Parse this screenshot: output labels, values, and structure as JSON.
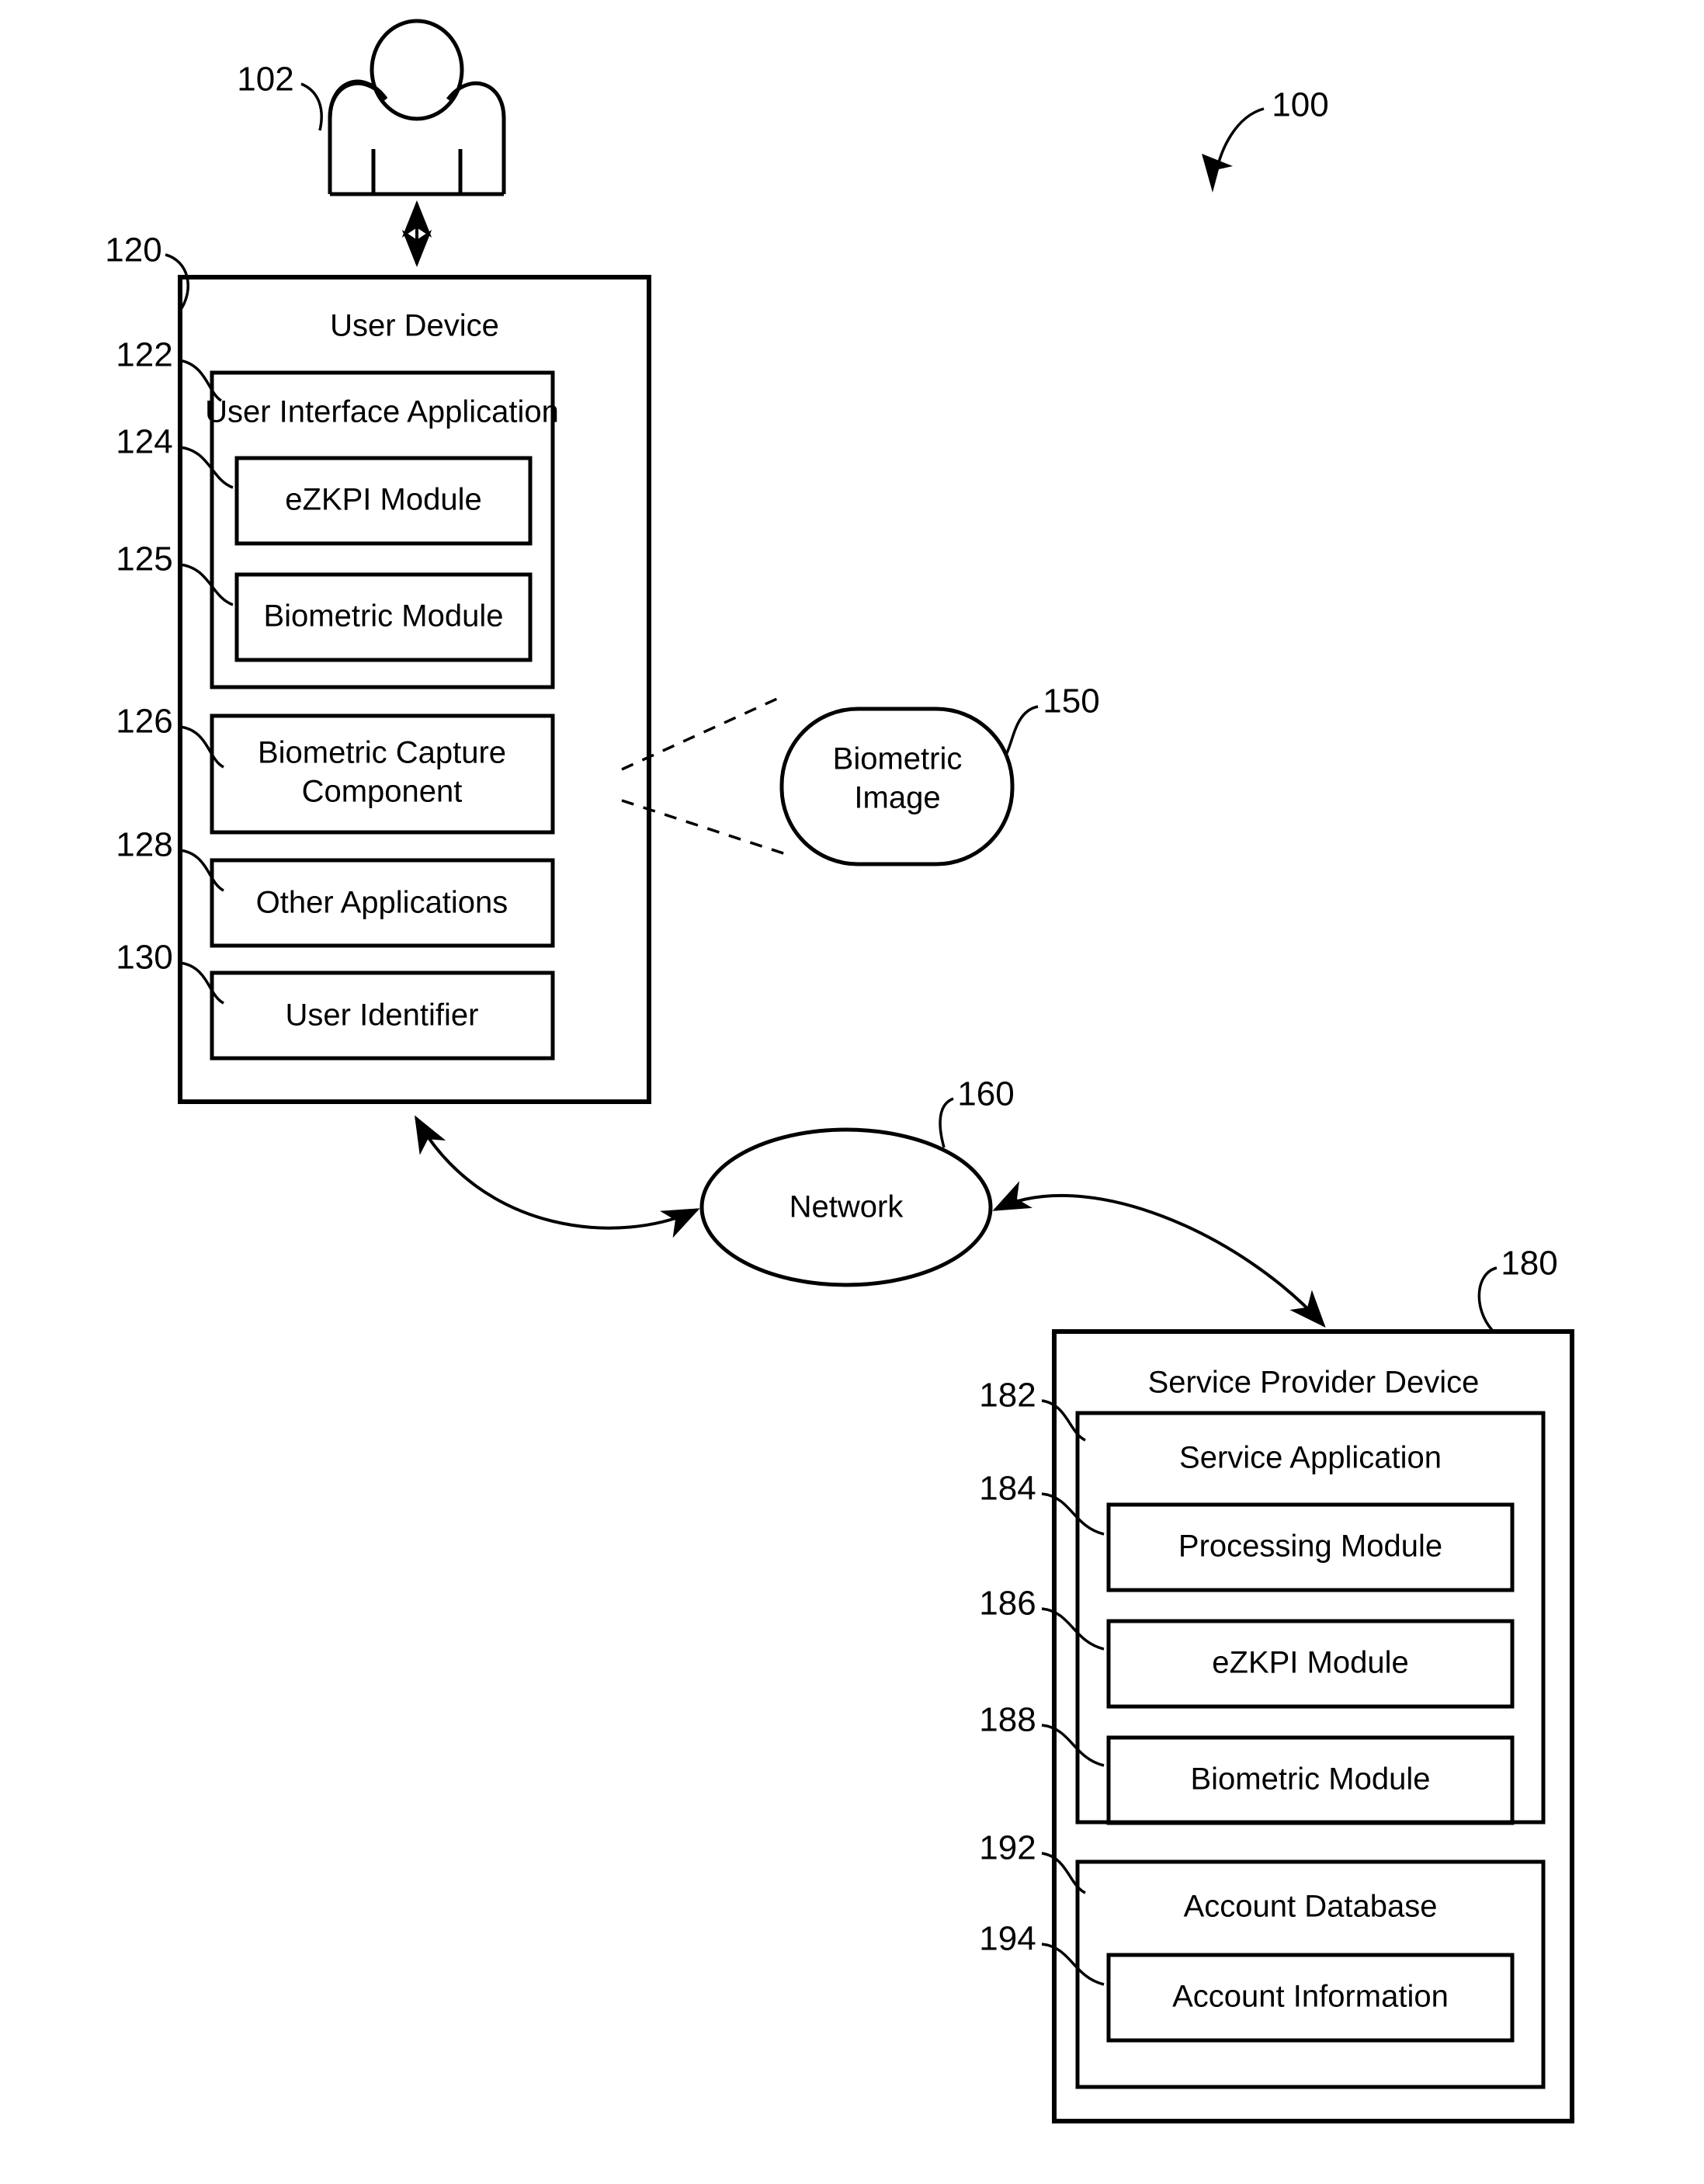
{
  "figure": {
    "system_ref": "100"
  },
  "actor": {
    "name": "user-actor",
    "ref": "102"
  },
  "user_device": {
    "title": "User Device",
    "ref": "120",
    "ui_application": {
      "title": "User Interface Application",
      "ref": "122",
      "modules": [
        {
          "label": "eZKPI Module",
          "ref": "124"
        },
        {
          "label": "Biometric Module",
          "ref": "125"
        }
      ]
    },
    "components": [
      {
        "label": "Biometric Capture Component",
        "label_line1": "Biometric Capture",
        "label_line2": "Component",
        "ref": "126"
      },
      {
        "label": "Other Applications",
        "ref": "128"
      },
      {
        "label": "User Identifier",
        "ref": "130"
      }
    ]
  },
  "biometric_image": {
    "label_line1": "Biometric",
    "label_line2": "Image",
    "ref": "150"
  },
  "network": {
    "label": "Network",
    "ref": "160"
  },
  "service_provider_device": {
    "title": "Service Provider Device",
    "ref": "180",
    "service_application": {
      "title": "Service Application",
      "ref": "182",
      "modules": [
        {
          "label": "Processing Module",
          "ref": "184"
        },
        {
          "label": "eZKPI Module",
          "ref": "186"
        },
        {
          "label": "Biometric Module",
          "ref": "188"
        }
      ]
    },
    "account_database": {
      "title": "Account Database",
      "ref": "192",
      "items": [
        {
          "label": "Account Information",
          "ref": "194"
        }
      ]
    }
  }
}
